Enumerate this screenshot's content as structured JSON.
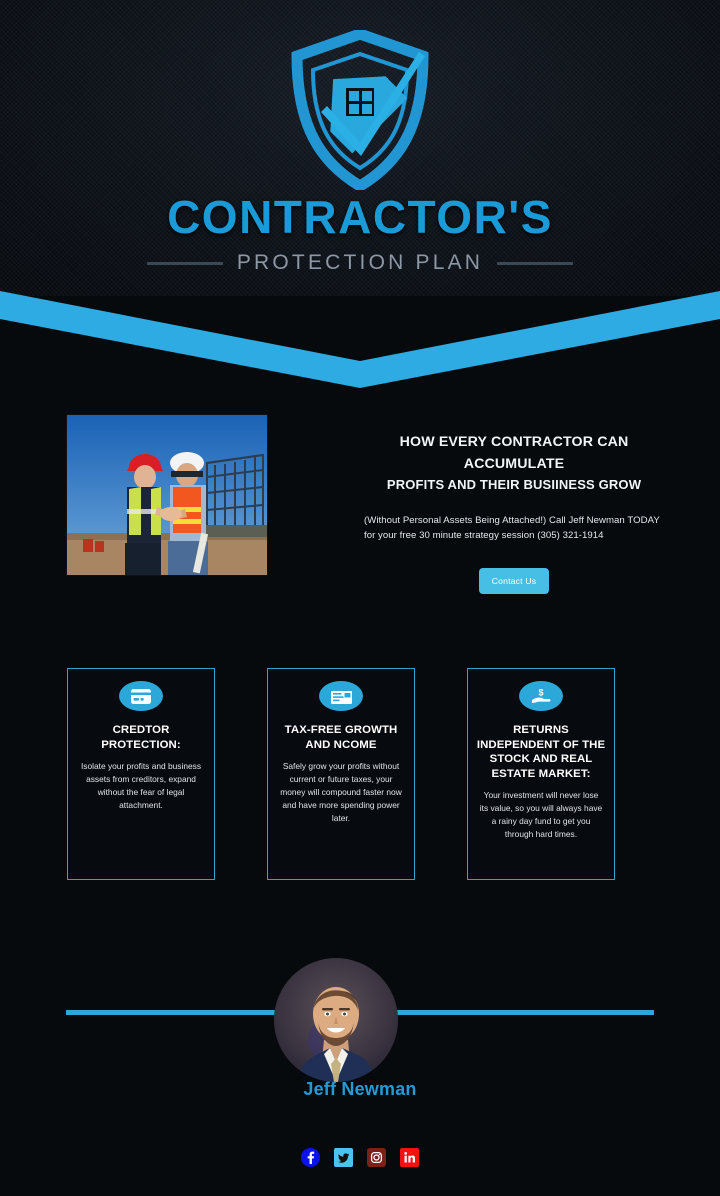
{
  "brand": {
    "name": "CONTRACTOR'S",
    "tagline": "PROTECTION PLAN",
    "logo_icon": "shield-house-check-icon",
    "accent_color": "#1a9ad6",
    "tagline_color": "#8d98a4"
  },
  "hero": {
    "photo_alt": "two-construction-workers-shaking-hands",
    "headline_line1": "HOW EVERY CONTRACTOR CAN ACCUMULATE",
    "headline_line2": "PROFITS AND THEIR BUSIINESS GROW",
    "subtext": "(Without Personal Assets Being Attached!) Call Jeff Newman TODAY for your free 30 minute strategy session (305) 321-1914",
    "phone": "(305) 321-1914",
    "cta_label": "Contact Us",
    "cta_color": "#47bfe5"
  },
  "cards": [
    {
      "icon": "credit-card-icon",
      "title": "CREDTOR PROTECTION:",
      "body": "Isolate your profits and business assets from creditors, expand without the fear of legal attachment."
    },
    {
      "icon": "invoice-document-icon",
      "title": "TAX-FREE GROWTH AND NCOME",
      "body": "Safely grow your profits without current or future taxes, your money will compound faster now and have more spending power later."
    },
    {
      "icon": "hand-holding-dollar-icon",
      "title": "RETURNS INDEPENDENT OF THE STOCK AND REAL ESTATE MARKET:",
      "body": "Your investment will never lose its value, so you will always have a rainy day fund to get you through hard times."
    }
  ],
  "footer": {
    "avatar_alt": "jeff-newman-headshot",
    "person_name": "Jeff Newman",
    "person_name_color": "#2399d6",
    "divider_color": "#2ba8d8",
    "socials": [
      {
        "name": "facebook",
        "label": "f",
        "color": "#0b14e8"
      },
      {
        "name": "twitter",
        "label": "t",
        "color": "#4cc2ee"
      },
      {
        "name": "instagram",
        "label": "ig",
        "color": "#7b2118"
      },
      {
        "name": "linkedin",
        "label": "in",
        "color": "#f51111"
      }
    ]
  },
  "theme": {
    "background": "#070a0d",
    "card_border": "#2da4d4",
    "card_icon_bg": "#2ba8d8"
  }
}
